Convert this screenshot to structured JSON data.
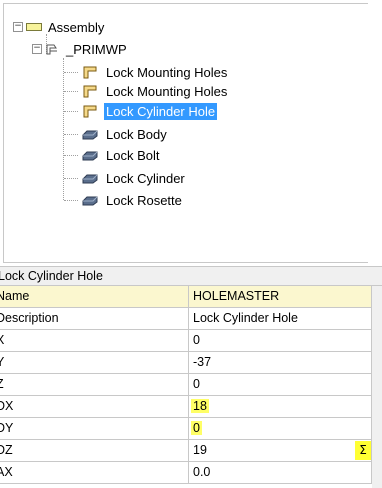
{
  "tree": {
    "root": {
      "label": "Assembly",
      "expander": "−"
    },
    "workplane": {
      "label": "_PRIMWP",
      "expander": "−"
    },
    "children": [
      {
        "label": "Lock Mounting Holes",
        "icon": "hole-feature-icon"
      },
      {
        "label": "Lock Mounting Holes",
        "icon": "hole-feature-icon"
      },
      {
        "label": "Lock Cylinder Hole",
        "icon": "hole-feature-icon",
        "selected": true
      },
      {
        "label": "Lock Body",
        "icon": "part-icon"
      },
      {
        "label": "Lock Bolt",
        "icon": "part-icon"
      },
      {
        "label": "Lock Cylinder",
        "icon": "part-icon"
      },
      {
        "label": "Lock Rosette",
        "icon": "part-icon"
      }
    ]
  },
  "properties": {
    "title": "Lock Cylinder Hole",
    "rows": [
      {
        "name": "Name",
        "value": "HOLEMASTER"
      },
      {
        "name": "Description",
        "value": "Lock Cylinder Hole"
      },
      {
        "name": "X",
        "value": "0"
      },
      {
        "name": "Y",
        "value": "-37"
      },
      {
        "name": "Z",
        "value": "0"
      },
      {
        "name": "DX",
        "value": "18"
      },
      {
        "name": "DY",
        "value": "0"
      },
      {
        "name": "DZ",
        "value": "19",
        "sigma": "Σ"
      },
      {
        "name": "AX",
        "value": "0.0"
      }
    ]
  },
  "colors": {
    "selection": "#3399ff",
    "highlight": "#ffff66",
    "first_row": "#fbf7cf"
  }
}
